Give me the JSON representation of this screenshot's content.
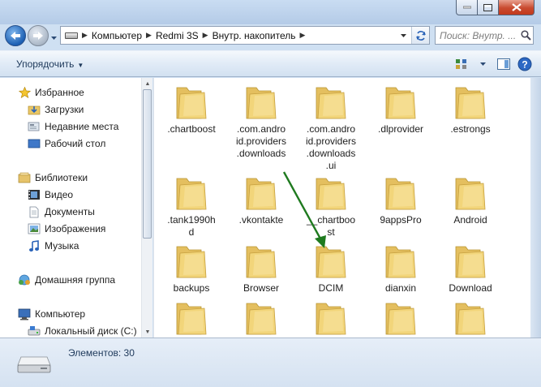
{
  "address": {
    "crumbs": [
      "Компьютер",
      "Redmi 3S",
      "Внутр. накопитель"
    ],
    "search_placeholder": "Поиск: Внутр. ..."
  },
  "toolbar": {
    "organize_label": "Упорядочить"
  },
  "nav": {
    "favorites_label": "Избранное",
    "downloads_label": "Загрузки",
    "recent_label": "Недавние места",
    "desktop_label": "Рабочий стол",
    "libraries_label": "Библиотеки",
    "video_label": "Видео",
    "documents_label": "Документы",
    "images_label": "Изображения",
    "music_label": "Музыка",
    "homegroup_label": "Домашняя группа",
    "computer_label": "Компьютер",
    "local_disk_label": "Локальный диск (C:)"
  },
  "folders": [
    ".chartboost",
    ".com.android.providers.downloads",
    ".com.android.providers.downloads.ui",
    ".dlprovider",
    ".estrongs",
    ".tank1990hd",
    ".vkontakte",
    "__chartboost",
    "9appsPro",
    "Android",
    "backups",
    "Browser",
    "DCIM",
    "dianxin",
    "Download",
    "",
    "",
    "",
    "",
    ""
  ],
  "folder_labels_wrapped": {
    "f1": ".com.andro\nid.providers\n.downloads",
    "f2": ".com.andro\nid.providers\n.downloads\n.ui",
    "f5": ".tank1990h\nd",
    "f7": "__chartboo\nst"
  },
  "status": {
    "items_count": "Элементов: 30"
  },
  "colors": {
    "folder": "#f2d57a",
    "arrow": "#1f7a1f",
    "frame": "#cfe0f2"
  }
}
